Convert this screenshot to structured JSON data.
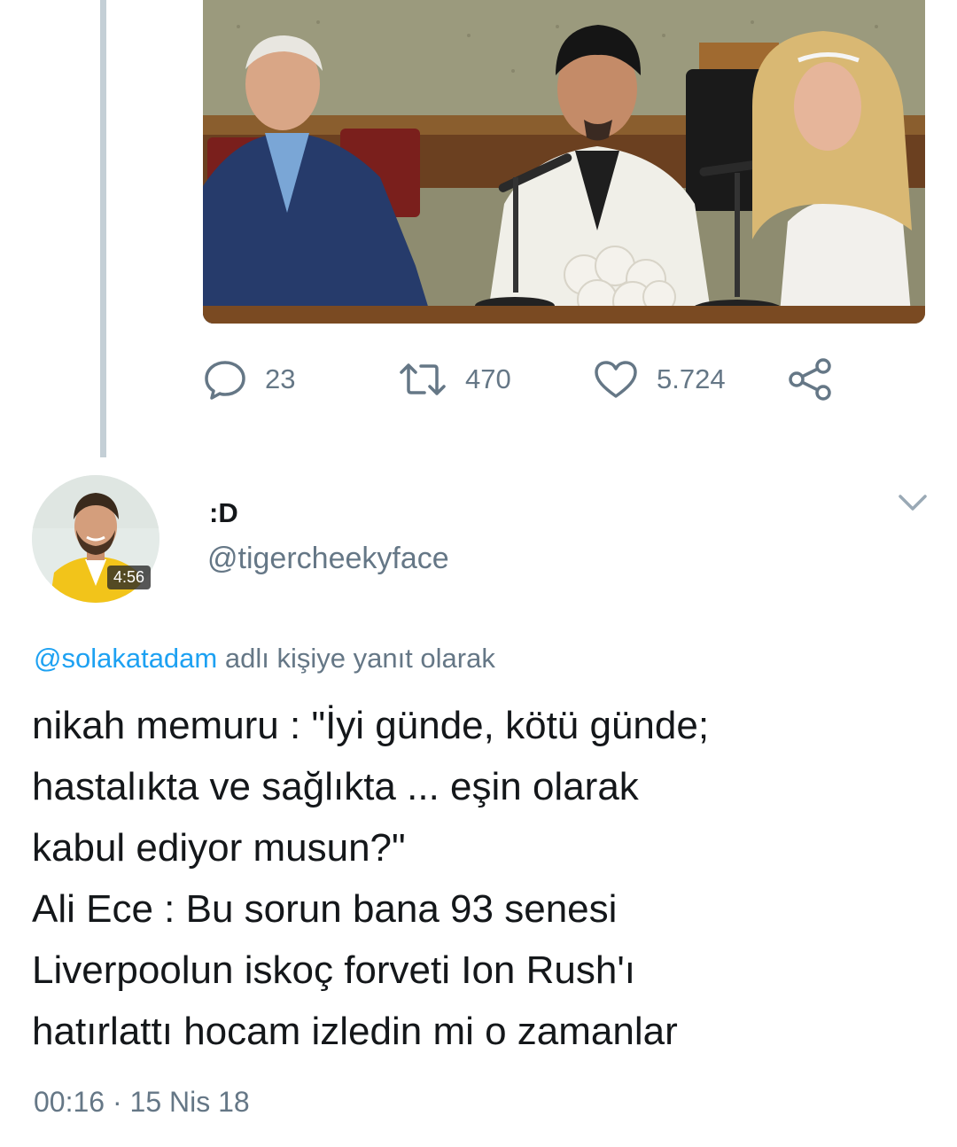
{
  "previous_tweet": {
    "counts": {
      "replies": "23",
      "retweets": "470",
      "likes": "5.724"
    },
    "icons": [
      "reply-icon",
      "retweet-icon",
      "like-icon",
      "share-icon"
    ]
  },
  "tweet": {
    "author": {
      "display_name": ":D",
      "handle": "@tigercheekyface",
      "avatar_badge": "4:56"
    },
    "reply_context": {
      "mention": "@solakatadam",
      "suffix": " adlı kişiye yanıt olarak"
    },
    "text_lines": [
      "nikah memuru : \"İyi günde, kötü günde;",
      "hastalıkta ve sağlıkta ... eşin olarak",
      "kabul ediyor musun?\"",
      "Ali Ece : Bu sorun bana 93 senesi",
      "Liverpoolun iskoç forveti Ion Rush'ı",
      "hatırlattı hocam izledin mi o zamanlar"
    ],
    "timestamp": "00:16 · 15 Nis 18"
  },
  "colors": {
    "text_primary": "#14171a",
    "text_secondary": "#657786",
    "link": "#1da1f2",
    "thread_line": "#c4cfd6"
  }
}
